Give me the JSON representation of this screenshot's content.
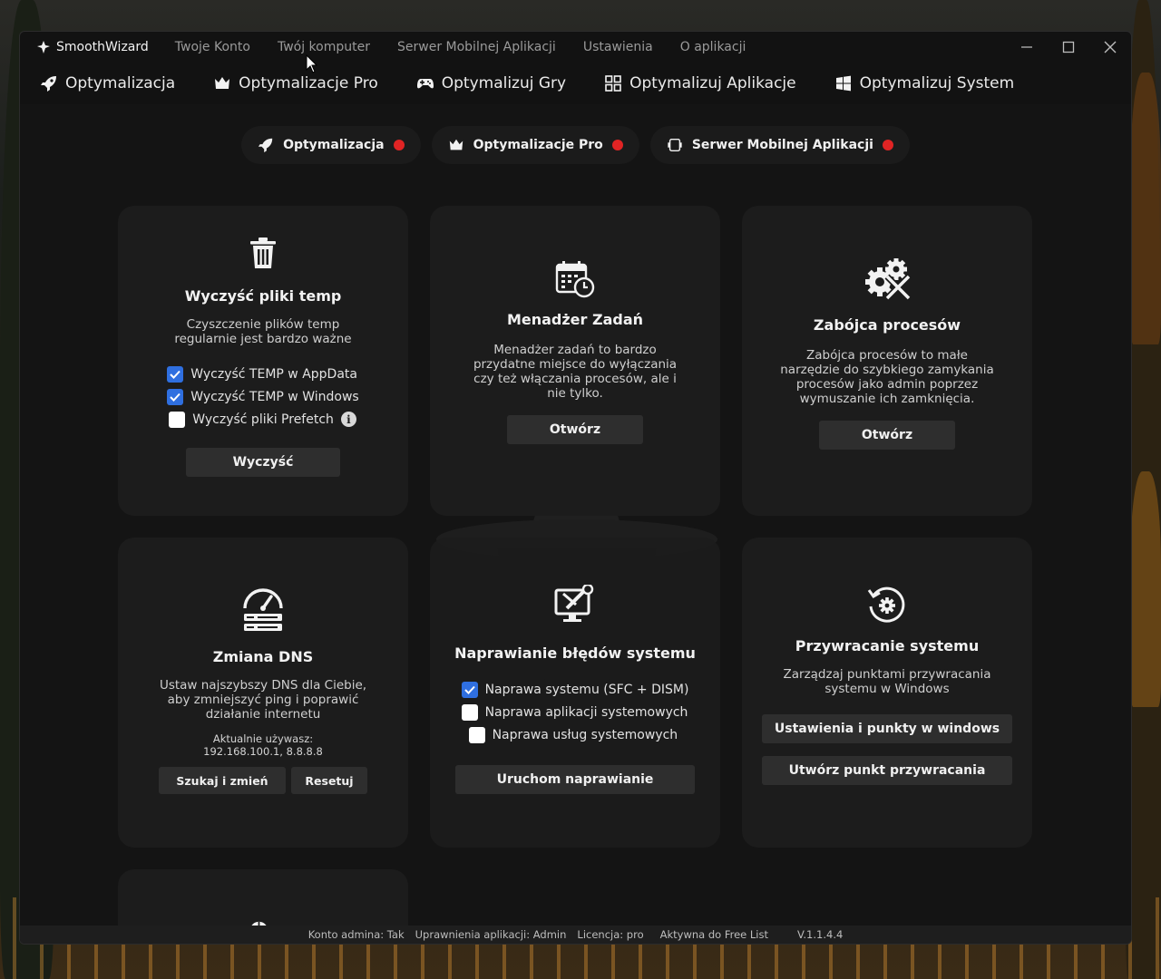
{
  "app": {
    "brand": "SmoothWizard",
    "menu": [
      "Twoje Konto",
      "Twój komputer",
      "Serwer Mobilnej Aplikacji",
      "Ustawienia",
      "O aplikacji"
    ]
  },
  "nav": [
    {
      "label": "Optymalizacja",
      "icon": "rocket-icon"
    },
    {
      "label": "Optymalizacje Pro",
      "icon": "crown-icon"
    },
    {
      "label": "Optymalizuj Gry",
      "icon": "gamepad-icon"
    },
    {
      "label": "Optymalizuj Aplikacje",
      "icon": "apps-grid-icon"
    },
    {
      "label": "Optymalizuj System",
      "icon": "windows-icon"
    }
  ],
  "pills": [
    {
      "label": "Optymalizacja",
      "icon": "rocket-icon",
      "status_color": "#e02424"
    },
    {
      "label": "Optymalizacje Pro",
      "icon": "crown-icon",
      "status_color": "#e02424"
    },
    {
      "label": "Serwer Mobilnej Aplikacji",
      "icon": "server-icon",
      "status_color": "#e02424"
    }
  ],
  "cards": {
    "temp": {
      "title": "Wyczyść pliki temp",
      "desc_lines": [
        "Czyszczenie plików temp",
        "regularnie jest bardzo ważne"
      ],
      "options": [
        {
          "label": "Wyczyść TEMP w AppData",
          "checked": true
        },
        {
          "label": "Wyczyść TEMP w Windows",
          "checked": true
        },
        {
          "label": "Wyczyść pliki Prefetch",
          "checked": false
        }
      ],
      "button": "Wyczyść"
    },
    "tasks": {
      "title": "Menadżer Zadań",
      "desc_lines": [
        "Menadżer zadań to bardzo",
        "przydatne miejsce do wyłączania",
        "czy też włączania procesów, ale i",
        "nie tylko."
      ],
      "button": "Otwórz"
    },
    "killer": {
      "title": "Zabójca procesów",
      "desc_lines": [
        "Zabójca procesów to małe",
        "narzędzie do szybkiego zamykania",
        "procesów jako admin poprzez",
        "wymuszanie ich zamknięcia."
      ],
      "button": "Otwórz"
    },
    "dns": {
      "title": "Zmiana DNS",
      "desc_lines": [
        "Ustaw najszybszy DNS dla Ciebie,",
        "aby zmniejszyć ping i poprawić",
        "działanie internetu"
      ],
      "current_label": "Aktualnie używasz:",
      "current_value": "192.168.100.1, 8.8.8.8",
      "button_search": "Szukaj i zmień",
      "button_reset": "Resetuj"
    },
    "repair": {
      "title": "Naprawianie błędów systemu",
      "options": [
        {
          "label": "Naprawa systemu (SFC + DISM)",
          "checked": true
        },
        {
          "label": "Naprawa aplikacji systemowych",
          "checked": false
        },
        {
          "label": "Naprawa usług systemowych",
          "checked": false
        }
      ],
      "button": "Uruchom naprawianie"
    },
    "restore": {
      "title": "Przywracanie systemu",
      "desc_lines": [
        "Zarządzaj punktami przywracania",
        "systemu w Windows"
      ],
      "button_settings": "Ustawienia i punkty w windows",
      "button_create": "Utwórz punkt przywracania"
    }
  },
  "status": {
    "admin": "Konto admina: Tak",
    "perms": "Uprawnienia aplikacji: Admin",
    "license": "Licencja: pro",
    "freelist": "Aktywna do Free List",
    "version": "V.1.1.4.4"
  },
  "colors": {
    "accent": "#2f6fe0",
    "status_red": "#e02424",
    "card": "#1c1c1c",
    "window": "#121212"
  }
}
